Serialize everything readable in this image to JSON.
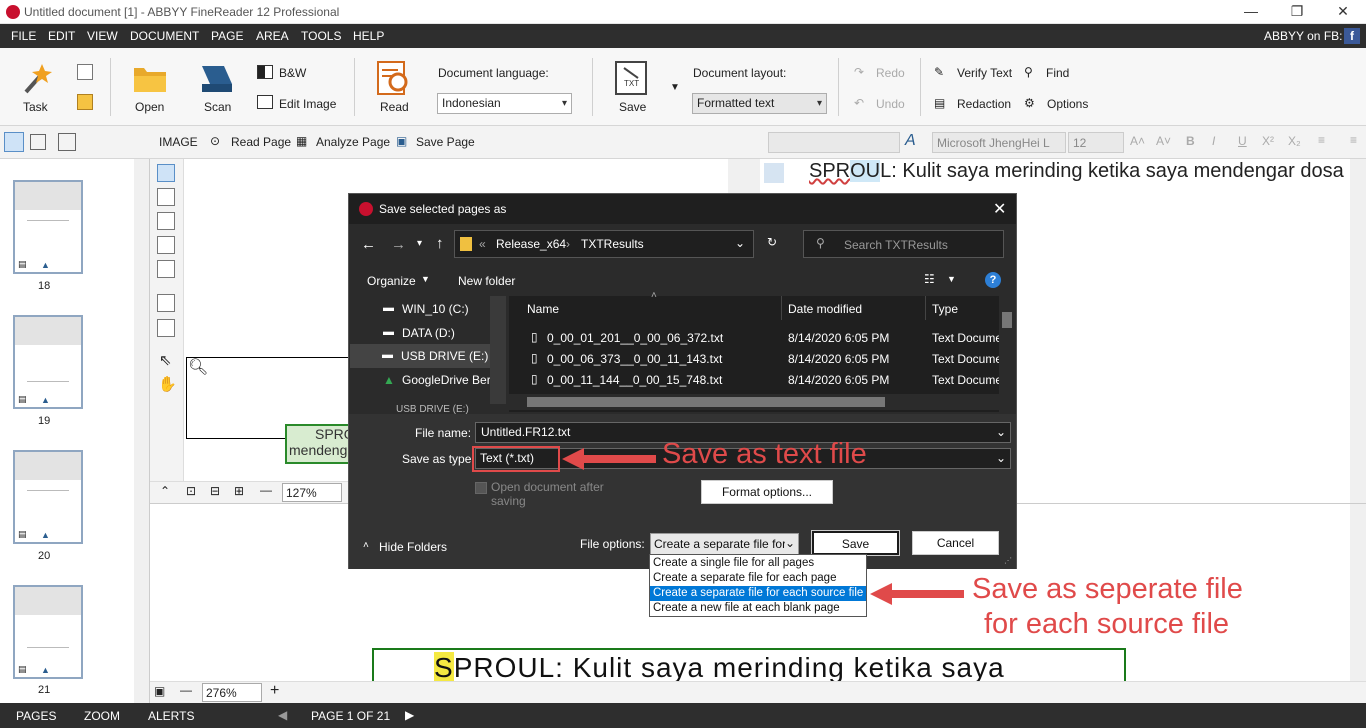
{
  "window": {
    "title": "Untitled document [1] - ABBYY FineReader 12 Professional",
    "fb_label": "ABBYY on FB:",
    "fb_icon": "f"
  },
  "menu": [
    "FILE",
    "EDIT",
    "VIEW",
    "DOCUMENT",
    "PAGE",
    "AREA",
    "TOOLS",
    "HELP"
  ],
  "ribbon": {
    "task": "Task",
    "open": "Open",
    "scan": "Scan",
    "bw": "B&W",
    "edit_image": "Edit Image",
    "read": "Read",
    "doc_language_label": "Document language:",
    "doc_language_value": "Indonesian",
    "save": "Save",
    "doc_layout_label": "Document layout:",
    "doc_layout_value": "Formatted text",
    "redo": "Redo",
    "undo": "Undo",
    "verify_text": "Verify Text",
    "redaction": "Redaction",
    "find": "Find",
    "options": "Options"
  },
  "image_toolbar": {
    "image": "IMAGE",
    "read_page": "Read Page",
    "analyze_page": "Analyze Page",
    "save_page": "Save Page"
  },
  "text_toolbar": {
    "font": "Microsoft JhengHei L",
    "size": "12"
  },
  "pages": [
    {
      "num": "18"
    },
    {
      "num": "19"
    },
    {
      "num": "20"
    },
    {
      "num": "21"
    }
  ],
  "image_view": {
    "text_line1": "SPRO",
    "text_line2": "mendeng",
    "zoom": "127%"
  },
  "text_view": {
    "line_pre": "SPR",
    "line_hl": "OU",
    "line_post": "L: Kulit saya merinding ketika saya mendengar dosa"
  },
  "zoom_view": {
    "first_letter": "S",
    "text": "PROUL: Kulit saya merinding ketika saya",
    "zoom": "276%"
  },
  "statusbar": {
    "pages": "PAGES",
    "zoom": "ZOOM",
    "alerts": "ALERTS",
    "page_info": "PAGE 1 OF 21"
  },
  "dialog": {
    "title": "Save selected pages as",
    "path_part1": "Release_x64",
    "path_part2": "TXTResults",
    "search_placeholder": "Search TXTResults",
    "organize": "Organize",
    "new_folder": "New folder",
    "nav_items": [
      "WIN_10 (C:)",
      "DATA (D:)",
      "USB DRIVE (E:)",
      "GoogleDrive Ber",
      "USB DRIVE (E:)"
    ],
    "columns": [
      "Name",
      "Date modified",
      "Type"
    ],
    "files": [
      {
        "name": "0_00_01_201__0_00_06_372.txt",
        "date": "8/14/2020 6:05 PM",
        "type": "Text Docume"
      },
      {
        "name": "0_00_06_373__0_00_11_143.txt",
        "date": "8/14/2020 6:05 PM",
        "type": "Text Docume"
      },
      {
        "name": "0_00_11_144__0_00_15_748.txt",
        "date": "8/14/2020 6:05 PM",
        "type": "Text Docume"
      }
    ],
    "file_name_label": "File name:",
    "file_name_value": "Untitled.FR12.txt",
    "save_type_label": "Save as type:",
    "save_type_value": "Text (*.txt)",
    "open_after_saving": "Open document after saving",
    "format_options": "Format options...",
    "hide_folders": "Hide Folders",
    "file_options_label": "File options:",
    "file_options_value": "Create a separate file for",
    "save_button": "Save",
    "cancel_button": "Cancel",
    "dropdown_options": [
      "Create a single file for all pages",
      "Create a separate file for each page",
      "Create a separate file for each source file",
      "Create a new file at each blank page"
    ]
  },
  "annotations": {
    "save_text": "Save as text file",
    "save_separate_1": "Save as seperate file",
    "save_separate_2": "for each source file"
  }
}
